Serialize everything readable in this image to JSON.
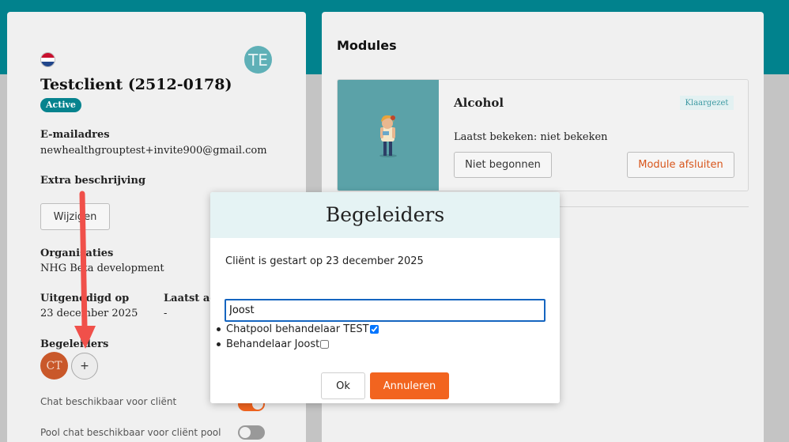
{
  "client": {
    "name": "Testclient (2512-0178)",
    "status": "Active",
    "avatar_initials": "TE"
  },
  "details": {
    "email_label": "E-mailadres",
    "email": "newhealthgrouptest+invite900@gmail.com",
    "extra_label": "Extra beschrijving",
    "edit_button": "Wijzigen",
    "org_label": "Organisaties",
    "org_value": "NHG Beta development",
    "invited_label": "Uitgenodigd op",
    "invited_value": "23 december 2025",
    "last_active_label": "Laatst actief",
    "last_active_value": "-",
    "begeleiders_label": "Begeleiders",
    "begeleider_initials": "CT",
    "add_symbol": "+",
    "chat_label": "Chat beschikbaar voor cliënt",
    "pool_chat_label": "Pool chat beschikbaar voor cliënt pool"
  },
  "toggles": {
    "chat_on": true,
    "pool_chat_on": false
  },
  "modules": {
    "title": "Modules",
    "items": [
      {
        "name": "Alcohol",
        "badge": "Klaargezet",
        "last_viewed": "Laatst bekeken: niet bekeken",
        "status_button": "Niet begonnen",
        "close_button": "Module afsluiten"
      }
    ]
  },
  "modal": {
    "title": "Begeleiders",
    "started_text": "Cliënt is gestart op 23 december 2025",
    "search_value": "Joost",
    "options": [
      {
        "label": "Chatpool behandelaar TEST",
        "checked": true
      },
      {
        "label": "Behandelaar Joost",
        "checked": false
      }
    ],
    "ok_button": "Ok",
    "cancel_button": "Annuleren"
  },
  "colors": {
    "teal": "#01828d",
    "accent_orange": "#f2641f",
    "arrow": "#f0504a"
  }
}
